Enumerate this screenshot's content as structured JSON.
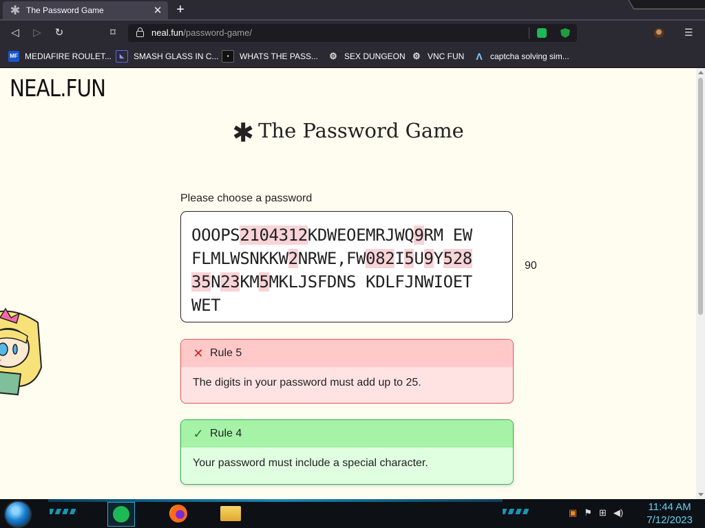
{
  "browser": {
    "tab_title": "The Password Game",
    "url_host": "neal.fun",
    "url_path": "/password-game/",
    "bookmarks": [
      {
        "label": "MEDIAFIRE ROULET...",
        "icon": "mediafire-icon"
      },
      {
        "label": "SMASH GLASS IN C...",
        "icon": "glass-icon"
      },
      {
        "label": "WHATS THE PASS...",
        "icon": "page-icon"
      },
      {
        "label": "SEX DUNGEON",
        "icon": "bot-icon"
      },
      {
        "label": "VNC FUN",
        "icon": "bot-icon"
      },
      {
        "label": "captcha solving sim...",
        "icon": "caret-icon"
      }
    ]
  },
  "page": {
    "logo": "NEAL.FUN",
    "title": "The Password Game",
    "title_icon": "✱",
    "prompt": "Please choose a password",
    "password_lines": [
      "OOOPS2104312KDWEOEMRJWQ9RM EW",
      "FLMLWSNKKW2NRWE,FW082I5U9Y528",
      "35N23KM5MKLJSFDNS KDLFJNWIOET",
      "WET"
    ],
    "char_count": "90",
    "rules": [
      {
        "id": "rule5",
        "status": "failed",
        "title": "Rule 5",
        "text": "The digits in your password must add up to 25."
      },
      {
        "id": "rule4",
        "status": "passed",
        "title": "Rule 4",
        "text": "Your password must include a special character."
      }
    ]
  },
  "taskbar": {
    "time": "11:44 AM",
    "date": "7/12/2023",
    "apps": [
      "spotify-icon",
      "firefox-icon",
      "file-explorer-icon"
    ]
  }
}
